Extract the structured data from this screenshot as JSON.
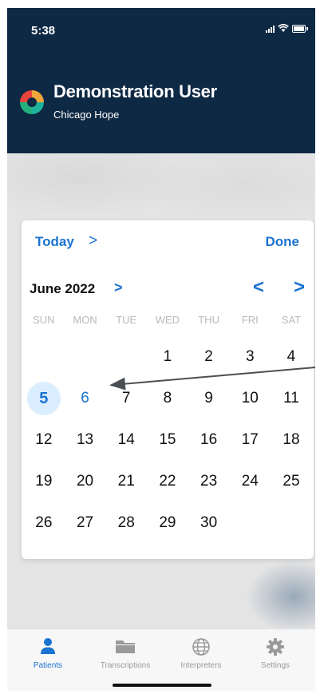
{
  "status_bar": {
    "time": "5:38"
  },
  "header": {
    "user_name": "Demonstration User",
    "organization": "Chicago Hope"
  },
  "date_picker": {
    "today_label": "Today",
    "today_chevron": ">",
    "done_label": "Done",
    "month_label": "June 2022",
    "month_chevron": ">",
    "prev_label": "<",
    "next_label": ">",
    "weekdays": [
      "SUN",
      "MON",
      "TUE",
      "WED",
      "THU",
      "FRI",
      "SAT"
    ],
    "weeks": [
      [
        "",
        "",
        "",
        "1",
        "2",
        "3",
        "4"
      ],
      [
        "5",
        "6",
        "7",
        "8",
        "9",
        "10",
        "11"
      ],
      [
        "12",
        "13",
        "14",
        "15",
        "16",
        "17",
        "18"
      ],
      [
        "19",
        "20",
        "21",
        "22",
        "23",
        "24",
        "25"
      ],
      [
        "26",
        "27",
        "28",
        "29",
        "30",
        "",
        ""
      ]
    ],
    "selected_day": "5",
    "highlighted_day": "6"
  },
  "tab_bar": {
    "tabs": [
      {
        "label": "Patients",
        "icon": "person-icon",
        "active": true
      },
      {
        "label": "Transcriptions",
        "icon": "folder-icon",
        "active": false
      },
      {
        "label": "Interpreters",
        "icon": "globe-icon",
        "active": false
      },
      {
        "label": "Settings",
        "icon": "gear-icon",
        "active": false
      }
    ]
  },
  "colors": {
    "header_bg": "#0e2944",
    "accent": "#1a73d1",
    "selected_bg": "#dbeeff"
  }
}
